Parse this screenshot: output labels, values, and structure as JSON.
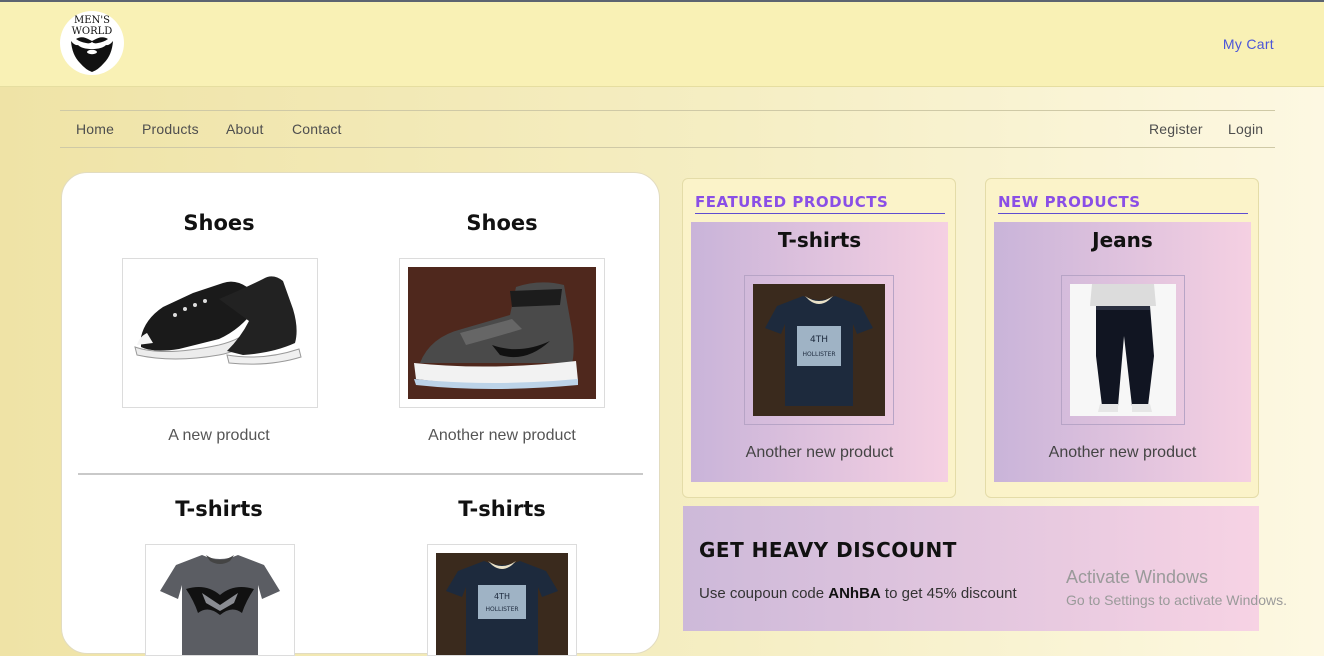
{
  "header": {
    "logo_line1": "MEN'S",
    "logo_line2": "WORLD",
    "cart_label": "My Cart"
  },
  "nav": {
    "left": [
      "Home",
      "Products",
      "About",
      "Contact"
    ],
    "right": [
      "Register",
      "Login"
    ]
  },
  "products": [
    {
      "title": "Shoes",
      "image": "sneaker-image",
      "description": "A new product"
    },
    {
      "title": "Shoes",
      "image": "high-top-shoe-image",
      "description": "Another new product"
    },
    {
      "title": "T-shirts",
      "image": "batman-tshirt-image",
      "description": ""
    },
    {
      "title": "T-shirts",
      "image": "hollister-tshirt-image",
      "description": ""
    }
  ],
  "featured": {
    "heading": "FEATURED PRODUCTS",
    "title": "T-shirts",
    "image": "hollister-tshirt-image",
    "description": "Another new product"
  },
  "new_products": {
    "heading": "NEW PRODUCTS",
    "title": "Jeans",
    "image": "jeans-image",
    "description": "Another new product"
  },
  "discount": {
    "title": "GET HEAVY DISCOUNT",
    "text_before": "Use coupoun code ",
    "code": "ANhBA",
    "text_after": " to get 45% discount"
  },
  "watermark": {
    "line1": "Activate Windows",
    "line2": "Go to Settings to activate Windows."
  },
  "colors": {
    "header_bg": "#f9f1b5",
    "accent_purple": "#8a4fe6",
    "cart_link": "#4b55d8"
  }
}
